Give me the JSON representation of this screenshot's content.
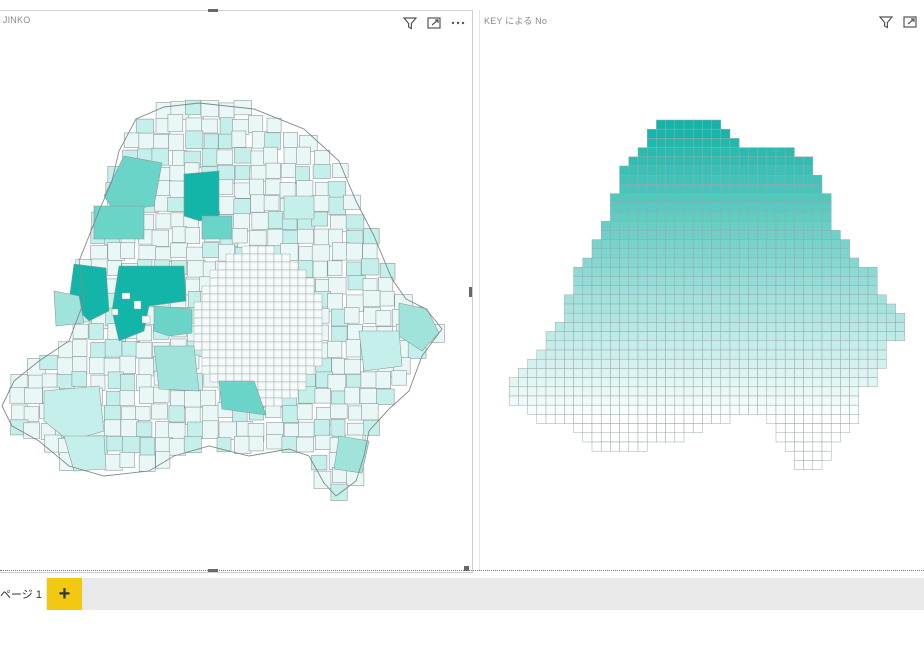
{
  "left_visual": {
    "title": "S JINKO",
    "icons": [
      "filter-icon",
      "focus-mode-icon",
      "more-options-icon"
    ],
    "fill_colors": [
      "#e9f8f6",
      "#c5efea",
      "#9fe3db",
      "#6ad4c8",
      "#13b5a8"
    ]
  },
  "right_visual": {
    "title": "KEY による No",
    "icons": [
      "filter-icon",
      "focus-mode-icon"
    ],
    "gradient": {
      "top": "#13b5a8",
      "bottom": "#ffffff"
    }
  },
  "tabs": {
    "page_label": "ページ 1",
    "add_symbol": "+"
  },
  "colors": {
    "accent": "#f2c811",
    "grid_line": "#9aa8a8",
    "map_border": "#8f9a9a"
  }
}
